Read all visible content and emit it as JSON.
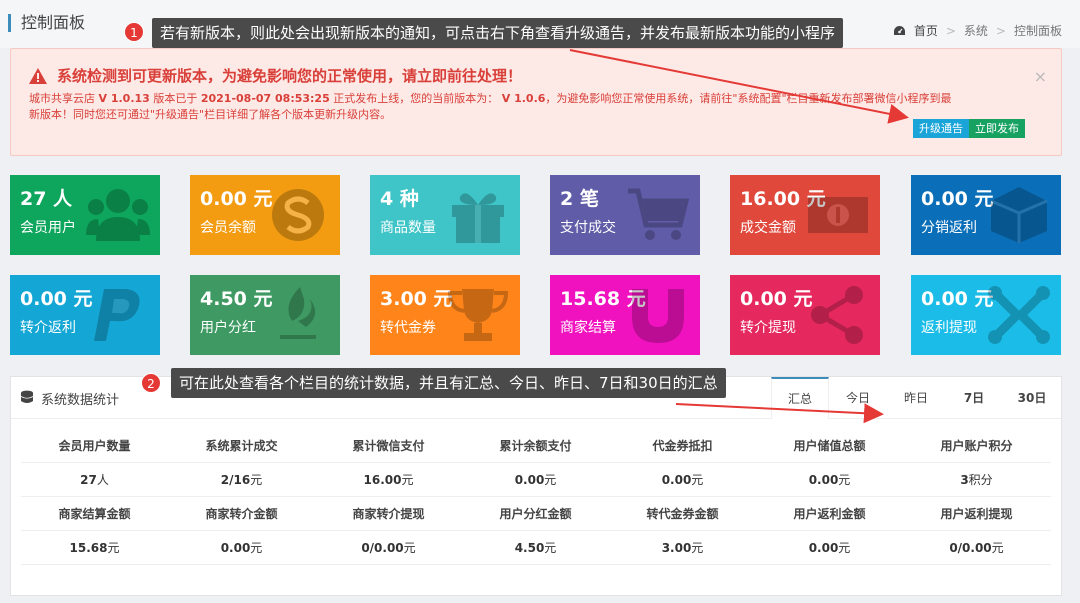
{
  "header": {
    "title": "控制面板",
    "breadcrumb": [
      "首页",
      "系统",
      "控制面板"
    ]
  },
  "alert": {
    "heading": "系统检测到可更新版本，为避免影响您的正常使用，请立即前往处理！",
    "line1_prefix": "城市共享云店",
    "line1_new_version": "V 1.0.13",
    "line1_mid": "版本已于",
    "line1_date": "2021-08-07 08:53:25",
    "line1_mid2": "正式发布上线，您的当前版本为：",
    "line1_cur_version": "V 1.0.6",
    "line1_suffix": "，为避免影响您正常使用系统，请前往\"系统配置\"栏目重新发布部署微信小程序到最",
    "line2": "新版本！同时您还可通过\"升级通告\"栏目详细了解各个版本更新升级内容。",
    "close_glyph": "×",
    "btn_notice": "升级通告",
    "btn_publish": "立即发布"
  },
  "callouts": {
    "c1_num": "1",
    "c1_text": "若有新版本，则此处会出现新版本的通知，可点击右下角查看升级通告，并发布最新版本功能的小程序",
    "c2_num": "2",
    "c2_text": "可在此处查看各个栏目的统计数据，并且有汇总、今日、昨日、7日和30日的汇总"
  },
  "tiles": [
    {
      "value": "27 人",
      "label": "会员用户",
      "icon": "users-icon",
      "color": "#0ea55c"
    },
    {
      "value": "0.00 元",
      "label": "会员余额",
      "icon": "skype-icon",
      "color": "#f39c12"
    },
    {
      "value": "4 种",
      "label": "商品数量",
      "icon": "gift-icon",
      "color": "#3fc4c7"
    },
    {
      "value": "2 笔",
      "label": "支付成交",
      "icon": "cart-icon",
      "color": "#605ca8"
    },
    {
      "value": "16.00 元",
      "label": "成交金额",
      "icon": "money-icon",
      "color": "#e0483c"
    },
    {
      "value": "0.00 元",
      "label": "分销返利",
      "icon": "cube-icon",
      "color": "#0a6fb8"
    },
    {
      "value": "0.00 元",
      "label": "转介返利",
      "icon": "paypal-icon",
      "color": "#14a7d6"
    },
    {
      "value": "4.50 元",
      "label": "用户分红",
      "icon": "leaf-icon",
      "color": "#3e9a62"
    },
    {
      "value": "3.00 元",
      "label": "转代金券",
      "icon": "trophy-icon",
      "color": "#ff851b"
    },
    {
      "value": "15.68 元",
      "label": "商家结算",
      "icon": "magnet-icon",
      "color": "#f012be"
    },
    {
      "value": "0.00 元",
      "label": "转介提现",
      "icon": "share-icon",
      "color": "#e5285d"
    },
    {
      "value": "0.00 元",
      "label": "返利提现",
      "icon": "joomla-icon",
      "color": "#1bbde8"
    }
  ],
  "stats": {
    "title": "系统数据统计",
    "tabs": [
      "汇总",
      "今日",
      "昨日",
      "7日",
      "30日"
    ],
    "row1_heads": [
      "会员用户数量",
      "系统累计成交",
      "累计微信支付",
      "累计余额支付",
      "代金券抵扣",
      "用户储值总额",
      "用户账户积分"
    ],
    "row1_vals": [
      {
        "n": "27",
        "u": "人"
      },
      {
        "n": "2/16",
        "u": "元"
      },
      {
        "n": "16.00",
        "u": "元"
      },
      {
        "n": "0.00",
        "u": "元"
      },
      {
        "n": "0.00",
        "u": "元"
      },
      {
        "n": "0.00",
        "u": "元"
      },
      {
        "n": "3",
        "u": "积分"
      }
    ],
    "row2_heads": [
      "商家结算金额",
      "商家转介金额",
      "商家转介提现",
      "用户分红金额",
      "转代金券金额",
      "用户返利金额",
      "用户返利提现"
    ],
    "row2_vals": [
      {
        "n": "15.68",
        "u": "元"
      },
      {
        "n": "0.00",
        "u": "元"
      },
      {
        "n": "0/0.00",
        "u": "元"
      },
      {
        "n": "4.50",
        "u": "元"
      },
      {
        "n": "3.00",
        "u": "元"
      },
      {
        "n": "0.00",
        "u": "元"
      },
      {
        "n": "0/0.00",
        "u": "元"
      }
    ]
  }
}
